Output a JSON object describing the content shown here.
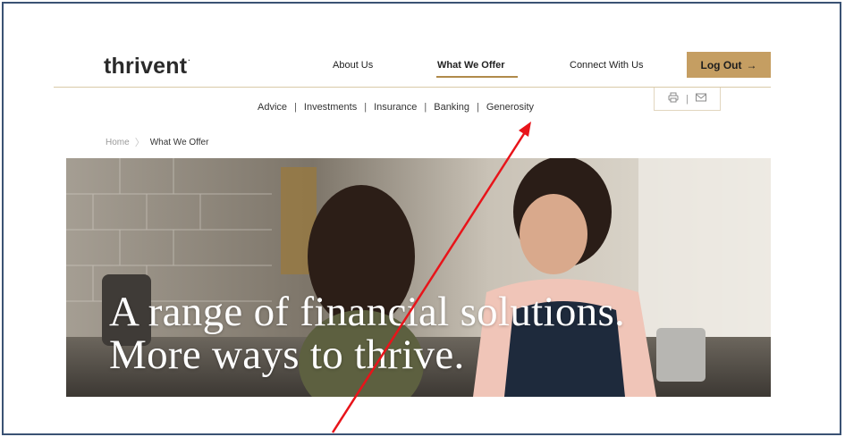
{
  "header": {
    "logo_text": "thrivent",
    "logo_mark": "·",
    "nav": [
      {
        "label": "About Us"
      },
      {
        "label": "What We Offer",
        "active": true
      },
      {
        "label": "Connect With Us"
      }
    ],
    "logout_label": "Log Out",
    "logout_icon": "→"
  },
  "subnav": {
    "items": [
      "Advice",
      "Investments",
      "Insurance",
      "Banking",
      "Generosity"
    ],
    "separator": "|"
  },
  "tools": {
    "print_icon": "print-icon",
    "email_icon": "email-icon",
    "divider": "|"
  },
  "breadcrumb": {
    "home": "Home",
    "separator": "〉",
    "current": "What We Offer"
  },
  "hero": {
    "line1": "A range of financial solutions.",
    "line2": "More ways to thrive."
  },
  "colors": {
    "accent_gold": "#c59e62",
    "annotation_arrow": "#e8141a",
    "frame_border": "#3a5273"
  }
}
